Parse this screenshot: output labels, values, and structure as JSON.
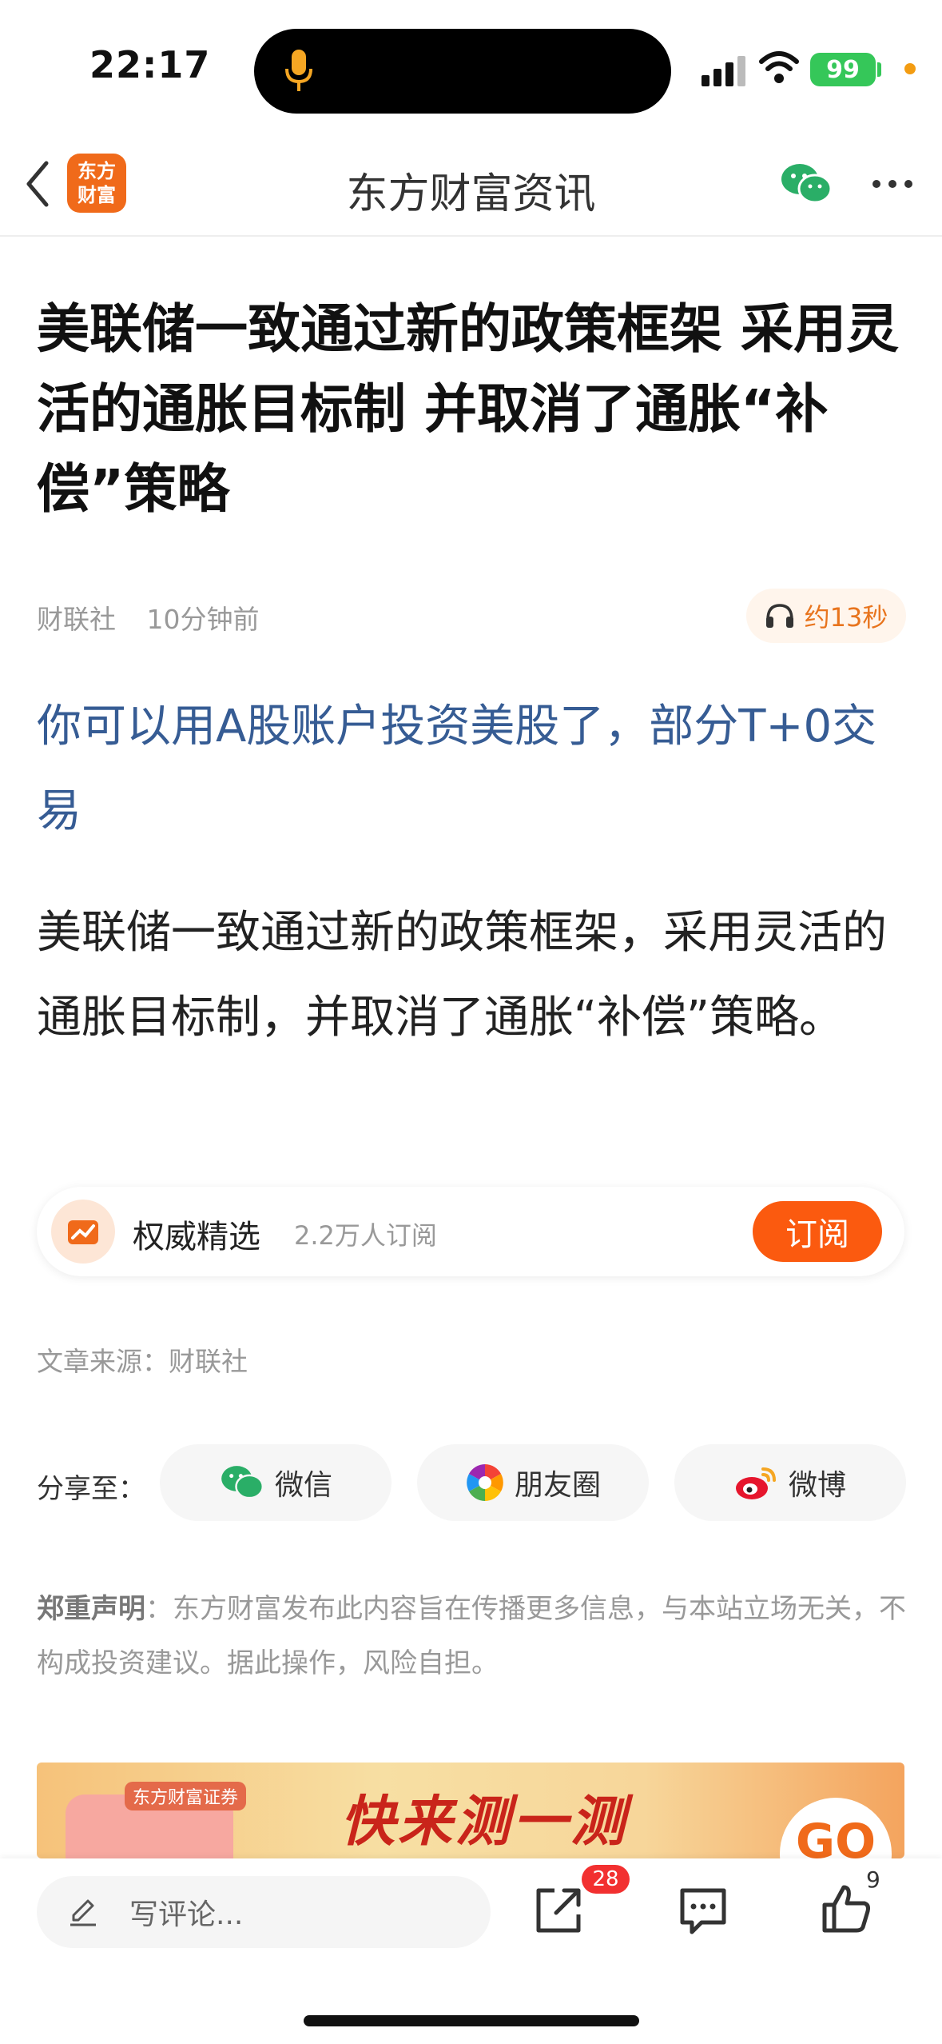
{
  "status": {
    "time": "22:17",
    "battery": "99"
  },
  "nav": {
    "logo_line1": "东方",
    "logo_line2": "财富",
    "title": "东方财富资讯"
  },
  "article": {
    "headline": "美联储一致通过新的政策框架 采用灵活的通胀目标制 并取消了通胀“补偿”策略",
    "source": "财联社",
    "time_ago": "10分钟前",
    "listen_label": "约13秒",
    "promo_link": "你可以用A股账户投资美股了，部分T+0交易",
    "body": "美联储一致通过新的政策框架，采用灵活的通胀目标制，并取消了通胀“补偿”策略。"
  },
  "subscription": {
    "name": "权威精选",
    "count": "2.2万人订阅",
    "button": "订阅"
  },
  "article_source": "文章来源：财联社",
  "share": {
    "label": "分享至：",
    "wechat": "微信",
    "moments": "朋友圈",
    "weibo": "微博"
  },
  "disclaimer": {
    "title": "郑重声明",
    "text": "：东方财富发布此内容旨在传播更多信息，与本站立场无关，不构成投资建议。据此操作，风险自担。"
  },
  "banner": {
    "brand": "东方财富证券",
    "title": "快来测一测",
    "go": "GO"
  },
  "bottom": {
    "comment_placeholder": "写评论...",
    "share_count": "28",
    "like_count": "9"
  },
  "colors": {
    "accent": "#fb5a0f",
    "link": "#365c94",
    "battery": "#35c759",
    "badge": "#f23030"
  }
}
